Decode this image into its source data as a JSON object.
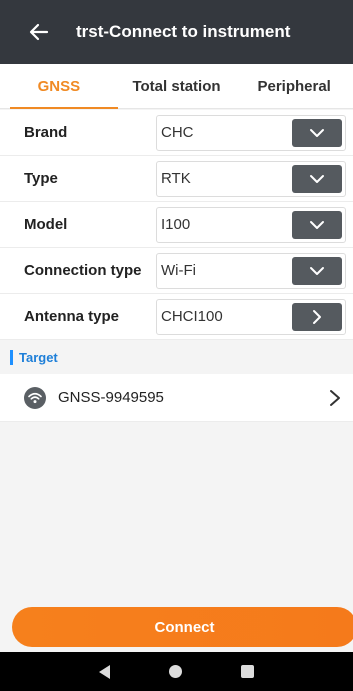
{
  "header": {
    "title": "trst-Connect to instrument",
    "back_icon": "arrow-left-icon"
  },
  "tabs": [
    {
      "label": "GNSS",
      "active": true
    },
    {
      "label": "Total station",
      "active": false
    },
    {
      "label": "Peripheral",
      "active": false
    }
  ],
  "form": {
    "rows": [
      {
        "label": "Brand",
        "value": "CHC",
        "button_icon": "chevron-down-icon"
      },
      {
        "label": "Type",
        "value": "RTK",
        "button_icon": "chevron-down-icon"
      },
      {
        "label": "Model",
        "value": "I100",
        "button_icon": "chevron-down-icon"
      },
      {
        "label": "Connection type",
        "value": "Wi-Fi",
        "button_icon": "chevron-down-icon"
      },
      {
        "label": "Antenna type",
        "value": "CHCI100",
        "button_icon": "chevron-right-icon"
      }
    ]
  },
  "target": {
    "section_title": "Target",
    "device_name": "GNSS-9949595",
    "icon": "wifi-icon"
  },
  "connect_label": "Connect",
  "colors": {
    "accent": "#f08a24",
    "header_bg": "#34383e",
    "section_blue": "#1e7fd8"
  }
}
